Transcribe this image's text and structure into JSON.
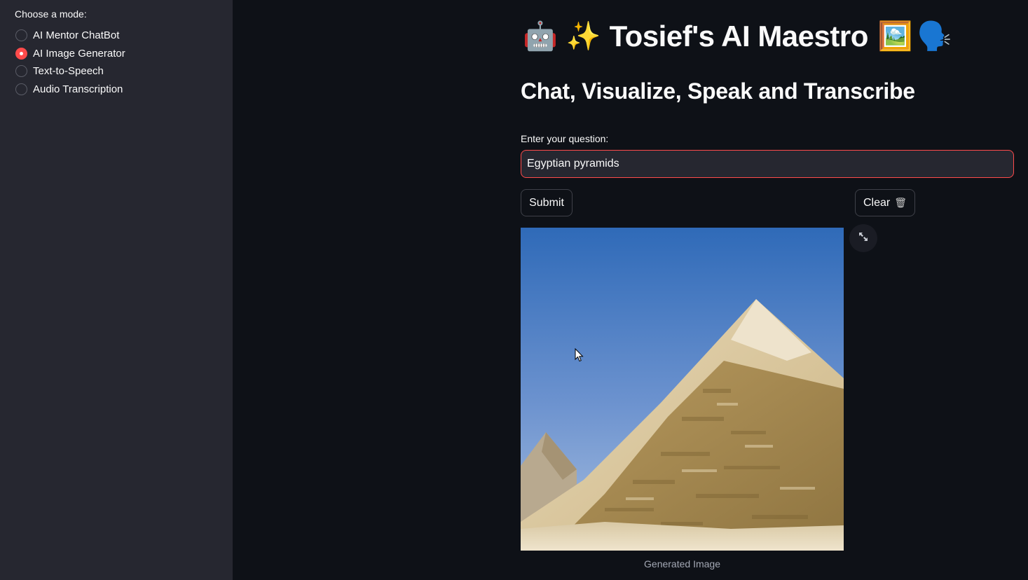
{
  "sidebar": {
    "mode_label": "Choose a mode:",
    "modes": [
      {
        "label": "AI Mentor ChatBot",
        "selected": false
      },
      {
        "label": "AI Image Generator",
        "selected": true
      },
      {
        "label": "Text-to-Speech",
        "selected": false
      },
      {
        "label": "Audio Transcription",
        "selected": false
      }
    ]
  },
  "header": {
    "emoji_before_1": "🤖",
    "emoji_before_2": "✨",
    "title": "Tosief's AI Maestro",
    "emoji_after_1": "🖼️",
    "emoji_after_2": "🗣️",
    "subtitle": "Chat, Visualize, Speak and Transcribe"
  },
  "form": {
    "question_label": "Enter your question:",
    "question_value": "Egyptian pyramids",
    "submit_label": "Submit",
    "clear_label": "Clear",
    "clear_icon": "🗑"
  },
  "output": {
    "image_caption": "Generated Image",
    "expand_icon": "fullscreen-icon"
  },
  "colors": {
    "accent": "#ff4b4b",
    "background": "#0e1117",
    "sidebar": "#262730"
  }
}
